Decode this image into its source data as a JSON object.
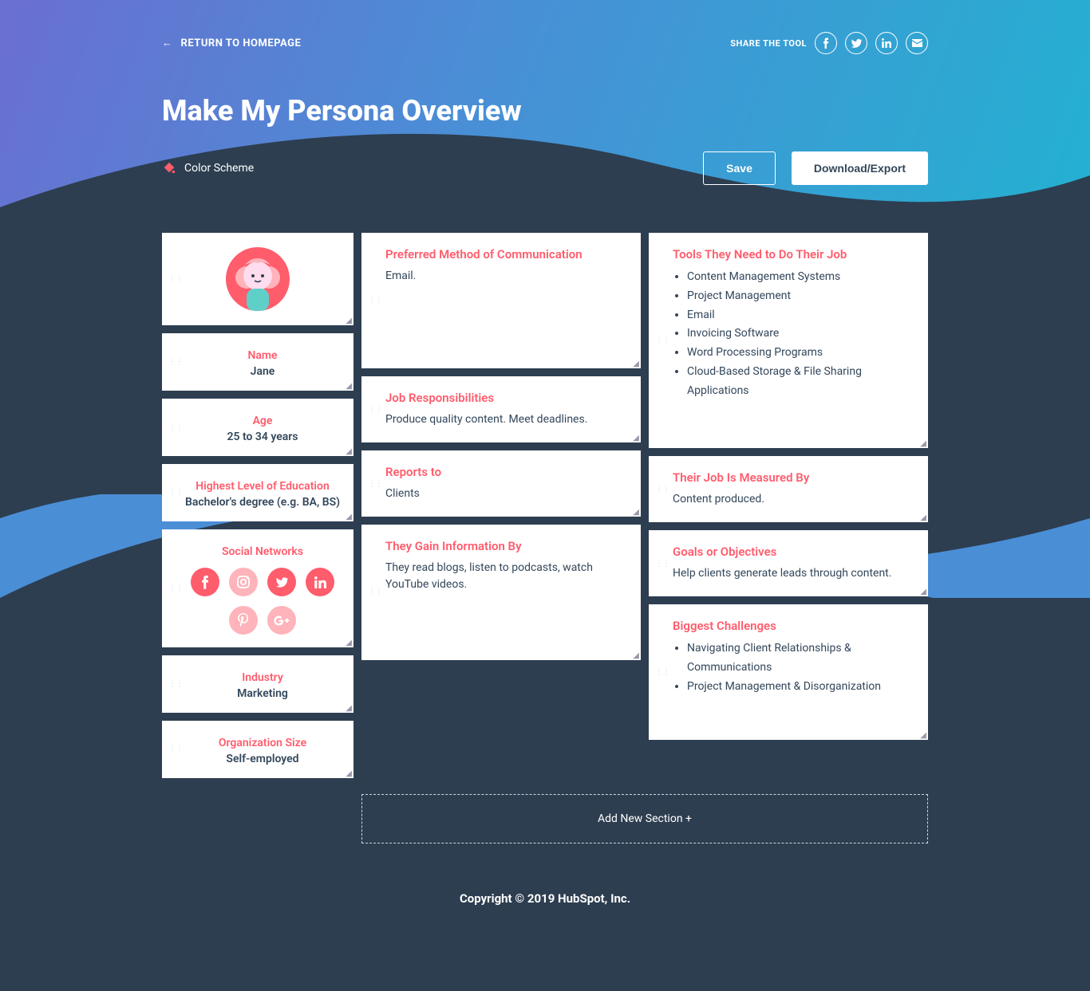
{
  "header": {
    "return_label": "RETURN TO HOMEPAGE",
    "share_label": "SHARE THE TOOL"
  },
  "page_title": "Make My Persona Overview",
  "toolbar": {
    "color_scheme_label": "Color Scheme",
    "save_label": "Save",
    "export_label": "Download/Export"
  },
  "persona": {
    "name_label": "Name",
    "name_value": "Jane",
    "age_label": "Age",
    "age_value": "25 to 34 years",
    "education_label": "Highest Level of Education",
    "education_value": "Bachelor's degree (e.g. BA, BS)",
    "social_label": "Social Networks",
    "industry_label": "Industry",
    "industry_value": "Marketing",
    "org_label": "Organization Size",
    "org_value": "Self-employed"
  },
  "cards": {
    "comm": {
      "title": "Preferred Method of Communication",
      "body": "Email."
    },
    "resp": {
      "title": "Job Responsibilities",
      "body": "Produce quality content. Meet deadlines."
    },
    "reports": {
      "title": "Reports to",
      "body": "Clients"
    },
    "info": {
      "title": "They Gain Information By",
      "body": "They read blogs, listen to podcasts, watch YouTube videos."
    },
    "tools": {
      "title": "Tools They Need to Do Their Job",
      "items": [
        "Content Management Systems",
        "Project Management",
        "Email",
        "Invoicing Software",
        "Word Processing Programs",
        "Cloud-Based Storage & File Sharing Applications"
      ]
    },
    "measured": {
      "title": "Their Job Is Measured By",
      "body": "Content produced."
    },
    "goals": {
      "title": "Goals or Objectives",
      "body": "Help clients generate leads through content."
    },
    "challenges": {
      "title": "Biggest Challenges",
      "items": [
        "Navigating Client Relationships & Communications",
        "Project Management & Disorganization"
      ]
    }
  },
  "add_section_label": "Add New Section",
  "footer": "Copyright © 2019 HubSpot, Inc."
}
